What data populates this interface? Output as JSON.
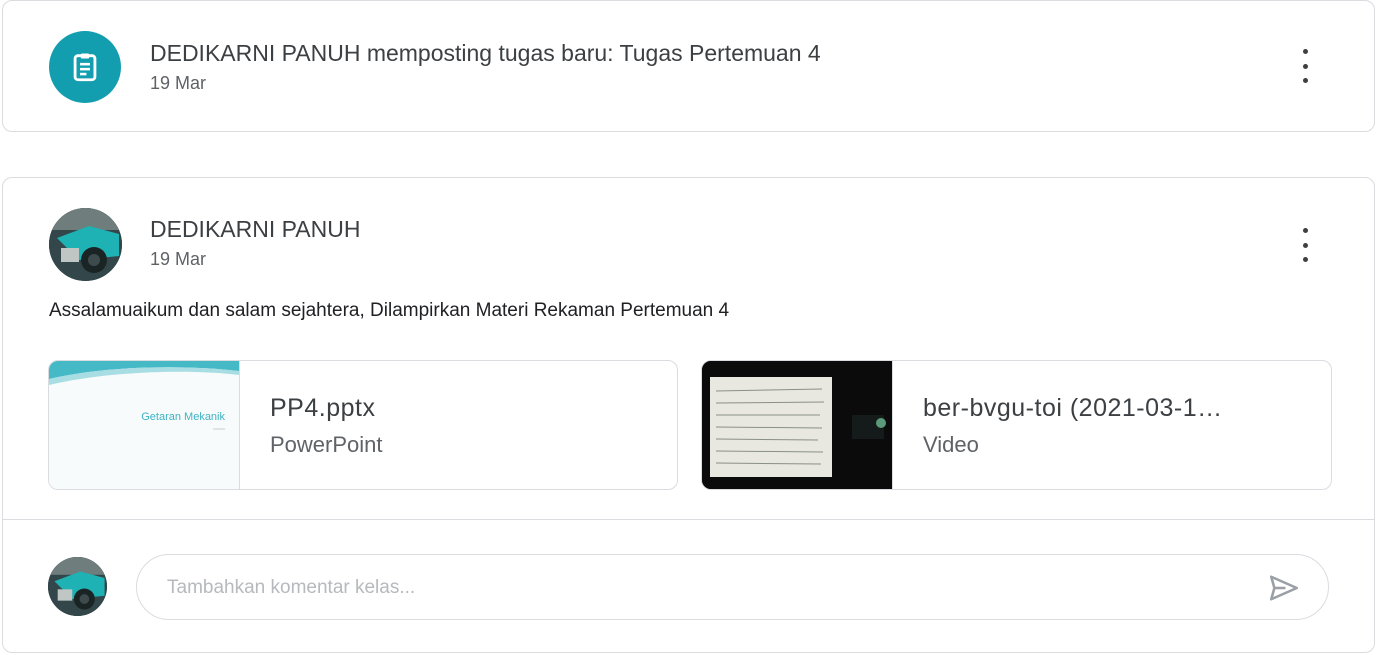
{
  "assignment_post": {
    "title": "DEDIKARNI PANUH memposting tugas baru: Tugas Pertemuan 4",
    "date": "19 Mar",
    "icon": "assignment-icon",
    "accent_color": "#129eaf"
  },
  "material_post": {
    "author": "DEDIKARNI PANUH",
    "date": "19 Mar",
    "body": "Assalamuaikum dan salam sejahtera, Dilampirkan Materi Rekaman Pertemuan 4",
    "attachments": [
      {
        "name": "PP4.pptx",
        "type": "PowerPoint",
        "thumb_text": "Getaran Mekanik"
      },
      {
        "name": "ber-bvgu-toi (2021-03-1…",
        "type": "Video"
      }
    ],
    "comment_placeholder": "Tambahkan komentar kelas...",
    "send_icon": "send-icon"
  }
}
